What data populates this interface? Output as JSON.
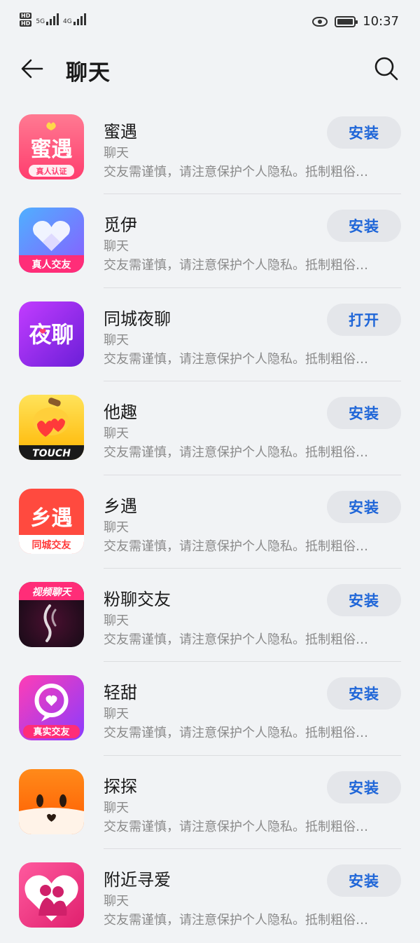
{
  "status_bar": {
    "sim1": "HD",
    "sim2": "HD",
    "net1": "5G",
    "net2": "4G",
    "time": "10:37"
  },
  "header": {
    "title": "聊天",
    "back_icon": "back-arrow-icon",
    "search_icon": "search-icon"
  },
  "apps": [
    {
      "name": "蜜遇",
      "category": "聊天",
      "desc": "交友需谨慎，请注意保护个人隐私。抵制粗俗…",
      "action": "安装",
      "icon_text": "蜜遇",
      "icon_sub": "真人认证",
      "colors": [
        "#ff6b8b",
        "#ff3d6e"
      ]
    },
    {
      "name": "觅伊",
      "category": "聊天",
      "desc": "交友需谨慎，请注意保护个人隐私。抵制粗俗…",
      "action": "安装",
      "icon_sub": "真人交友",
      "colors": [
        "#5aa9ff",
        "#7a5cff"
      ]
    },
    {
      "name": "同城夜聊",
      "category": "聊天",
      "desc": "交友需谨慎，请注意保护个人隐私。抵制粗俗…",
      "action": "打开",
      "icon_text": "夜聊",
      "colors": [
        "#b03cff",
        "#6b1fd8"
      ]
    },
    {
      "name": "他趣",
      "category": "聊天",
      "desc": "交友需谨慎，请注意保护个人隐私。抵制粗俗…",
      "action": "安装",
      "icon_text": "TOUCH",
      "colors": [
        "#ffd84a",
        "#ffb400"
      ]
    },
    {
      "name": "乡遇",
      "category": "聊天",
      "desc": "交友需谨慎，请注意保护个人隐私。抵制粗俗…",
      "action": "安装",
      "icon_text": "乡遇",
      "icon_sub": "同城交友",
      "colors": [
        "#ff5a4a",
        "#ff3a3a"
      ]
    },
    {
      "name": "粉聊交友",
      "category": "聊天",
      "desc": "交友需谨慎，请注意保护个人隐私。抵制粗俗…",
      "action": "安装",
      "icon_text": "视频聊天",
      "colors": [
        "#1a0f1f",
        "#3a0f2f"
      ]
    },
    {
      "name": "轻甜",
      "category": "聊天",
      "desc": "交友需谨慎，请注意保护个人隐私。抵制粗俗…",
      "action": "安装",
      "icon_sub": "真实交友",
      "colors": [
        "#ff3db5",
        "#8a3cff"
      ]
    },
    {
      "name": "探探",
      "category": "聊天",
      "desc": "交友需谨慎，请注意保护个人隐私。抵制粗俗…",
      "action": "安装",
      "colors": [
        "#ff7a1a",
        "#ff5a00"
      ]
    },
    {
      "name": "附近寻爱",
      "category": "聊天",
      "desc": "交友需谨慎，请注意保护个人隐私。抵制粗俗…",
      "action": "安装",
      "colors": [
        "#ff4d8f",
        "#e8257a"
      ]
    }
  ],
  "accent_color": "#1f66d8"
}
